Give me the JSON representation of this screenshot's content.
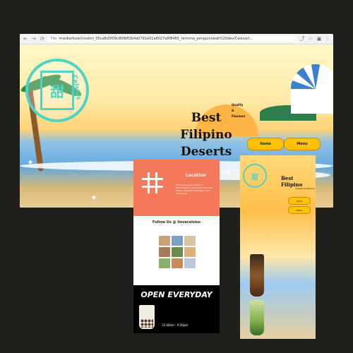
{
  "browser": {
    "nav": {
      "back": "←",
      "forward": "→",
      "reload": "⟳"
    },
    "address_label": "File",
    "url": "/media/fuse/crostini_05ca8d3f09c80fbff2b4a0791e01a8027a8f8465_termina_penguin/web%20dev/Celsius/i..."
  },
  "hero": {
    "logo_mark": "甜",
    "logo_word": "Celsius",
    "headline": [
      "Best",
      "Filipino",
      "Deserts"
    ],
    "tagline": [
      "Quality",
      "&",
      "Flavours"
    ],
    "buttons": [
      "Items",
      "Menu"
    ]
  },
  "mobile_info": {
    "location_title": "Location",
    "location_text": "We are proudly located in Mandaluyong, drop by for the best filipino desserts everyday in the Philippines.",
    "follow": "Follow Us @ ilovecelsius",
    "open_title": "OPEN EVERYDAY",
    "hours": "12:00am - 9:30pm"
  },
  "mobile_home": {
    "logo_mark": "甜",
    "title": "Best Filipino",
    "tagline": "Quality & Flavours",
    "buttons": [
      "Items",
      "Menu"
    ]
  },
  "colors": {
    "accent": "#4fd3c4",
    "button": "#ffc107",
    "coral": "#f5785a"
  }
}
